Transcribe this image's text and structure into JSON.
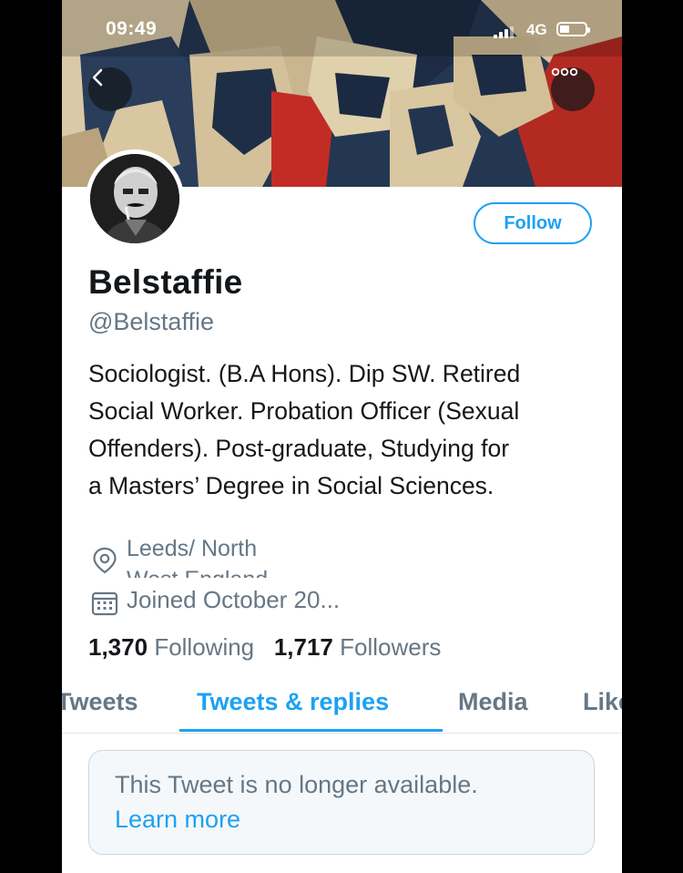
{
  "status_bar": {
    "time": "09:49",
    "network": "4G"
  },
  "header": {
    "back_icon": "chevron-left-icon",
    "more_icon": "more-horizontal-icon"
  },
  "profile": {
    "follow_label": "Follow",
    "display_name": "Belstaffie",
    "handle": "@Belstaffie",
    "bio": "Sociologist. (B.A Hons). Dip SW. Retired Social Worker. Probation Officer (Sexual Offenders). Post-graduate, Studying for a Masters’ Degree in Social Sciences.",
    "location": "Leeds/ North West England",
    "location_icon": "location-pin-icon",
    "joined": "Joined October 20...",
    "joined_icon": "calendar-icon",
    "following_count": "1,370",
    "following_label": "Following",
    "followers_count": "1,717",
    "followers_label": "Followers"
  },
  "tabs": [
    {
      "label": "Tweets",
      "active": false
    },
    {
      "label": "Tweets & replies",
      "active": true
    },
    {
      "label": "Media",
      "active": false
    },
    {
      "label": "Likes",
      "active": false
    }
  ],
  "notice": {
    "text": "This Tweet is no longer available.",
    "link": "Learn more"
  },
  "colors": {
    "accent": "#1da1f2",
    "secondary_text": "#657786",
    "primary_text": "#14171a"
  }
}
